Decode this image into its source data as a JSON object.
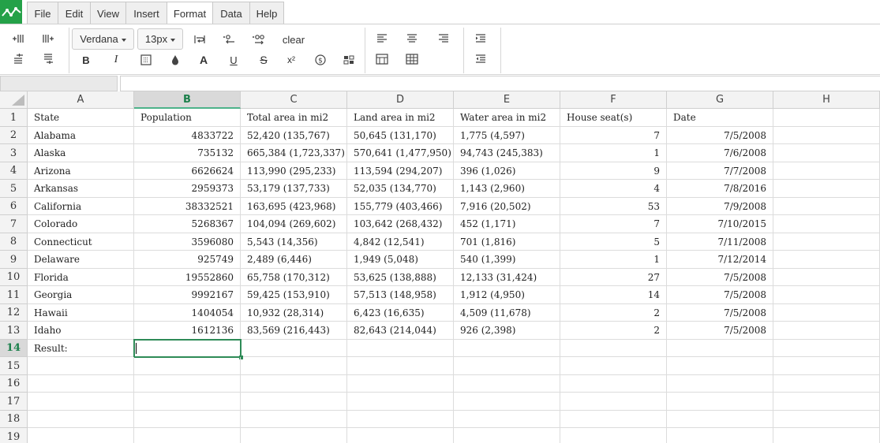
{
  "menu": {
    "items": [
      {
        "label": "File"
      },
      {
        "label": "Edit"
      },
      {
        "label": "View"
      },
      {
        "label": "Insert"
      },
      {
        "label": "Format"
      },
      {
        "label": "Data"
      },
      {
        "label": "Help"
      }
    ],
    "active": "Format"
  },
  "toolbar": {
    "font_family": "Verdana",
    "font_size": "13px",
    "clear_label": "clear",
    "bold_label": "B",
    "italic_label": "I",
    "font_color_label": "A",
    "underline_label": "U",
    "strike_label": "S",
    "superscript_label": "x²",
    "currency_label": "$"
  },
  "formula": {
    "cell_ref": "",
    "value": ""
  },
  "sheet": {
    "columns": [
      "A",
      "B",
      "C",
      "D",
      "E",
      "F",
      "G",
      "H"
    ],
    "selected_column": "B",
    "selected_row": "14",
    "rows": [
      {
        "n": "1",
        "cells": [
          "State",
          "Population",
          "Total area in mi2",
          "Land area in mi2",
          "Water area in mi2",
          "House seat(s)",
          "Date",
          ""
        ]
      },
      {
        "n": "2",
        "cells": [
          "Alabama",
          "4833722",
          "52,420 (135,767)",
          "50,645 (131,170)",
          "1,775 (4,597)",
          "7",
          "7/5/2008",
          ""
        ]
      },
      {
        "n": "3",
        "cells": [
          "Alaska",
          "735132",
          "665,384 (1,723,337)",
          "570,641 (1,477,950)",
          "94,743 (245,383)",
          "1",
          "7/6/2008",
          ""
        ]
      },
      {
        "n": "4",
        "cells": [
          "Arizona",
          "6626624",
          "113,990 (295,233)",
          "113,594 (294,207)",
          "396 (1,026)",
          "9",
          "7/7/2008",
          ""
        ]
      },
      {
        "n": "5",
        "cells": [
          "Arkansas",
          "2959373",
          "53,179 (137,733)",
          "52,035 (134,770)",
          "1,143 (2,960)",
          "4",
          "7/8/2016",
          ""
        ]
      },
      {
        "n": "6",
        "cells": [
          "California",
          "38332521",
          "163,695 (423,968)",
          "155,779 (403,466)",
          "7,916 (20,502)",
          "53",
          "7/9/2008",
          ""
        ]
      },
      {
        "n": "7",
        "cells": [
          "Colorado",
          "5268367",
          "104,094 (269,602)",
          "103,642 (268,432)",
          "452 (1,171)",
          "7",
          "7/10/2015",
          ""
        ]
      },
      {
        "n": "8",
        "cells": [
          "Connecticut",
          "3596080",
          "5,543 (14,356)",
          "4,842 (12,541)",
          "701 (1,816)",
          "5",
          "7/11/2008",
          ""
        ]
      },
      {
        "n": "9",
        "cells": [
          "Delaware",
          "925749",
          "2,489 (6,446)",
          "1,949 (5,048)",
          "540 (1,399)",
          "1",
          "7/12/2014",
          ""
        ]
      },
      {
        "n": "10",
        "cells": [
          "Florida",
          "19552860",
          "65,758 (170,312)",
          "53,625 (138,888)",
          "12,133 (31,424)",
          "27",
          "7/5/2008",
          ""
        ]
      },
      {
        "n": "11",
        "cells": [
          "Georgia",
          "9992167",
          "59,425 (153,910)",
          "57,513 (148,958)",
          "1,912 (4,950)",
          "14",
          "7/5/2008",
          ""
        ]
      },
      {
        "n": "12",
        "cells": [
          "Hawaii",
          "1404054",
          "10,932 (28,314)",
          "6,423 (16,635)",
          "4,509 (11,678)",
          "2",
          "7/5/2008",
          ""
        ]
      },
      {
        "n": "13",
        "cells": [
          "Idaho",
          "1612136",
          "83,569 (216,443)",
          "82,643 (214,044)",
          "926 (2,398)",
          "2",
          "7/5/2008",
          ""
        ]
      },
      {
        "n": "14",
        "cells": [
          "Result:",
          "",
          "",
          "",
          "",
          "",
          "",
          ""
        ]
      },
      {
        "n": "15",
        "cells": [
          "",
          "",
          "",
          "",
          "",
          "",
          "",
          ""
        ]
      },
      {
        "n": "16",
        "cells": [
          "",
          "",
          "",
          "",
          "",
          "",
          "",
          ""
        ]
      },
      {
        "n": "17",
        "cells": [
          "",
          "",
          "",
          "",
          "",
          "",
          "",
          ""
        ]
      },
      {
        "n": "18",
        "cells": [
          "",
          "",
          "",
          "",
          "",
          "",
          "",
          ""
        ]
      },
      {
        "n": "19",
        "cells": [
          "",
          "",
          "",
          "",
          "",
          "",
          "",
          ""
        ]
      }
    ]
  },
  "colors": {
    "accent": "#2e8b57",
    "logo": "#24a148"
  }
}
